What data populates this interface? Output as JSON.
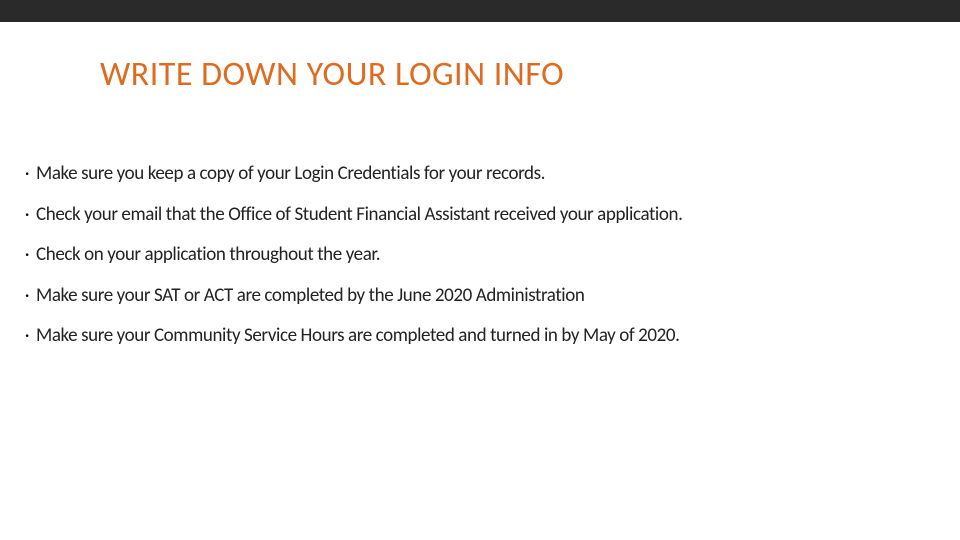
{
  "title": "WRITE DOWN YOUR LOGIN INFO",
  "bullets": [
    "Make sure you keep a copy of your Login Credentials for your records.",
    "Check your email that the Office of Student Financial Assistant received your application.",
    "Check on your application throughout the year.",
    "Make sure your SAT or ACT are completed by the June 2020 Administration",
    "Make sure your Community Service Hours are completed and turned in by May of 2020."
  ]
}
